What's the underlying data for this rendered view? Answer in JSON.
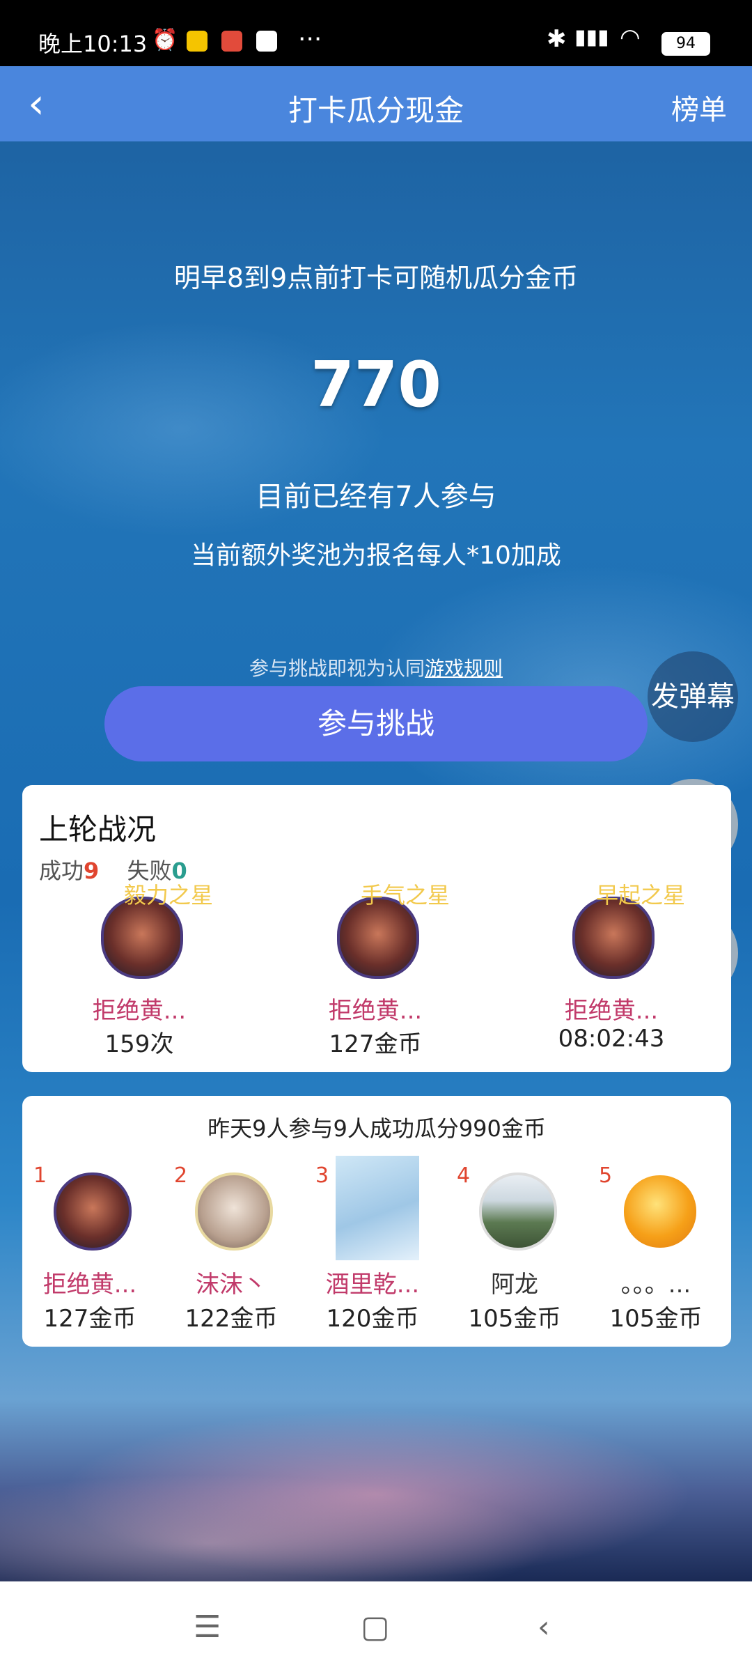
{
  "status_bar": {
    "time": "晚上10:13",
    "dots": "···",
    "battery": "94"
  },
  "header": {
    "back_icon": "back-chevron",
    "title": "打卡瓜分现金",
    "rank_label": "榜单"
  },
  "hero": {
    "subtitle": "明早8到9点前打卡可随机瓜分金币",
    "amount": "770",
    "participants": "目前已经有7人参与",
    "bonus": "当前额外奖池为报名每人*10加成"
  },
  "rules": {
    "prefix": "参与挑战即视为认同",
    "link": "游戏规则"
  },
  "join_button": "参与挑战",
  "danmu_button": "发弹幕",
  "last_round": {
    "title": "上轮战况",
    "success_label": "成功",
    "success_count": "9",
    "fail_label": "失败",
    "fail_count": "0",
    "stars": [
      {
        "badge": "毅力之星",
        "name": "拒绝黄...",
        "value": "159次"
      },
      {
        "badge": "手气之星",
        "name": "拒绝黄...",
        "value": "127金币"
      },
      {
        "badge": "早起之星",
        "name": "拒绝黄...",
        "value": "08:02:43"
      }
    ]
  },
  "yesterday": {
    "summary": "昨天9人参与9人成功瓜分990金币",
    "ranking": [
      {
        "rank": "1",
        "name": "拒绝黄...",
        "value": "127金币"
      },
      {
        "rank": "2",
        "name": "沫沫丶",
        "value": "122金币"
      },
      {
        "rank": "3",
        "name": "酒里乾...",
        "value": "120金币"
      },
      {
        "rank": "4",
        "name": "阿龙",
        "value": "105金币"
      },
      {
        "rank": "5",
        "name": "。。。...",
        "value": "105金币"
      }
    ]
  },
  "colors": {
    "header_bg": "#4a86dd",
    "button_bg": "#5b6ee8",
    "success": "#e0452f",
    "fail": "#2a9d8f",
    "badge": "#f2c94c",
    "name": "#c13a6a"
  }
}
